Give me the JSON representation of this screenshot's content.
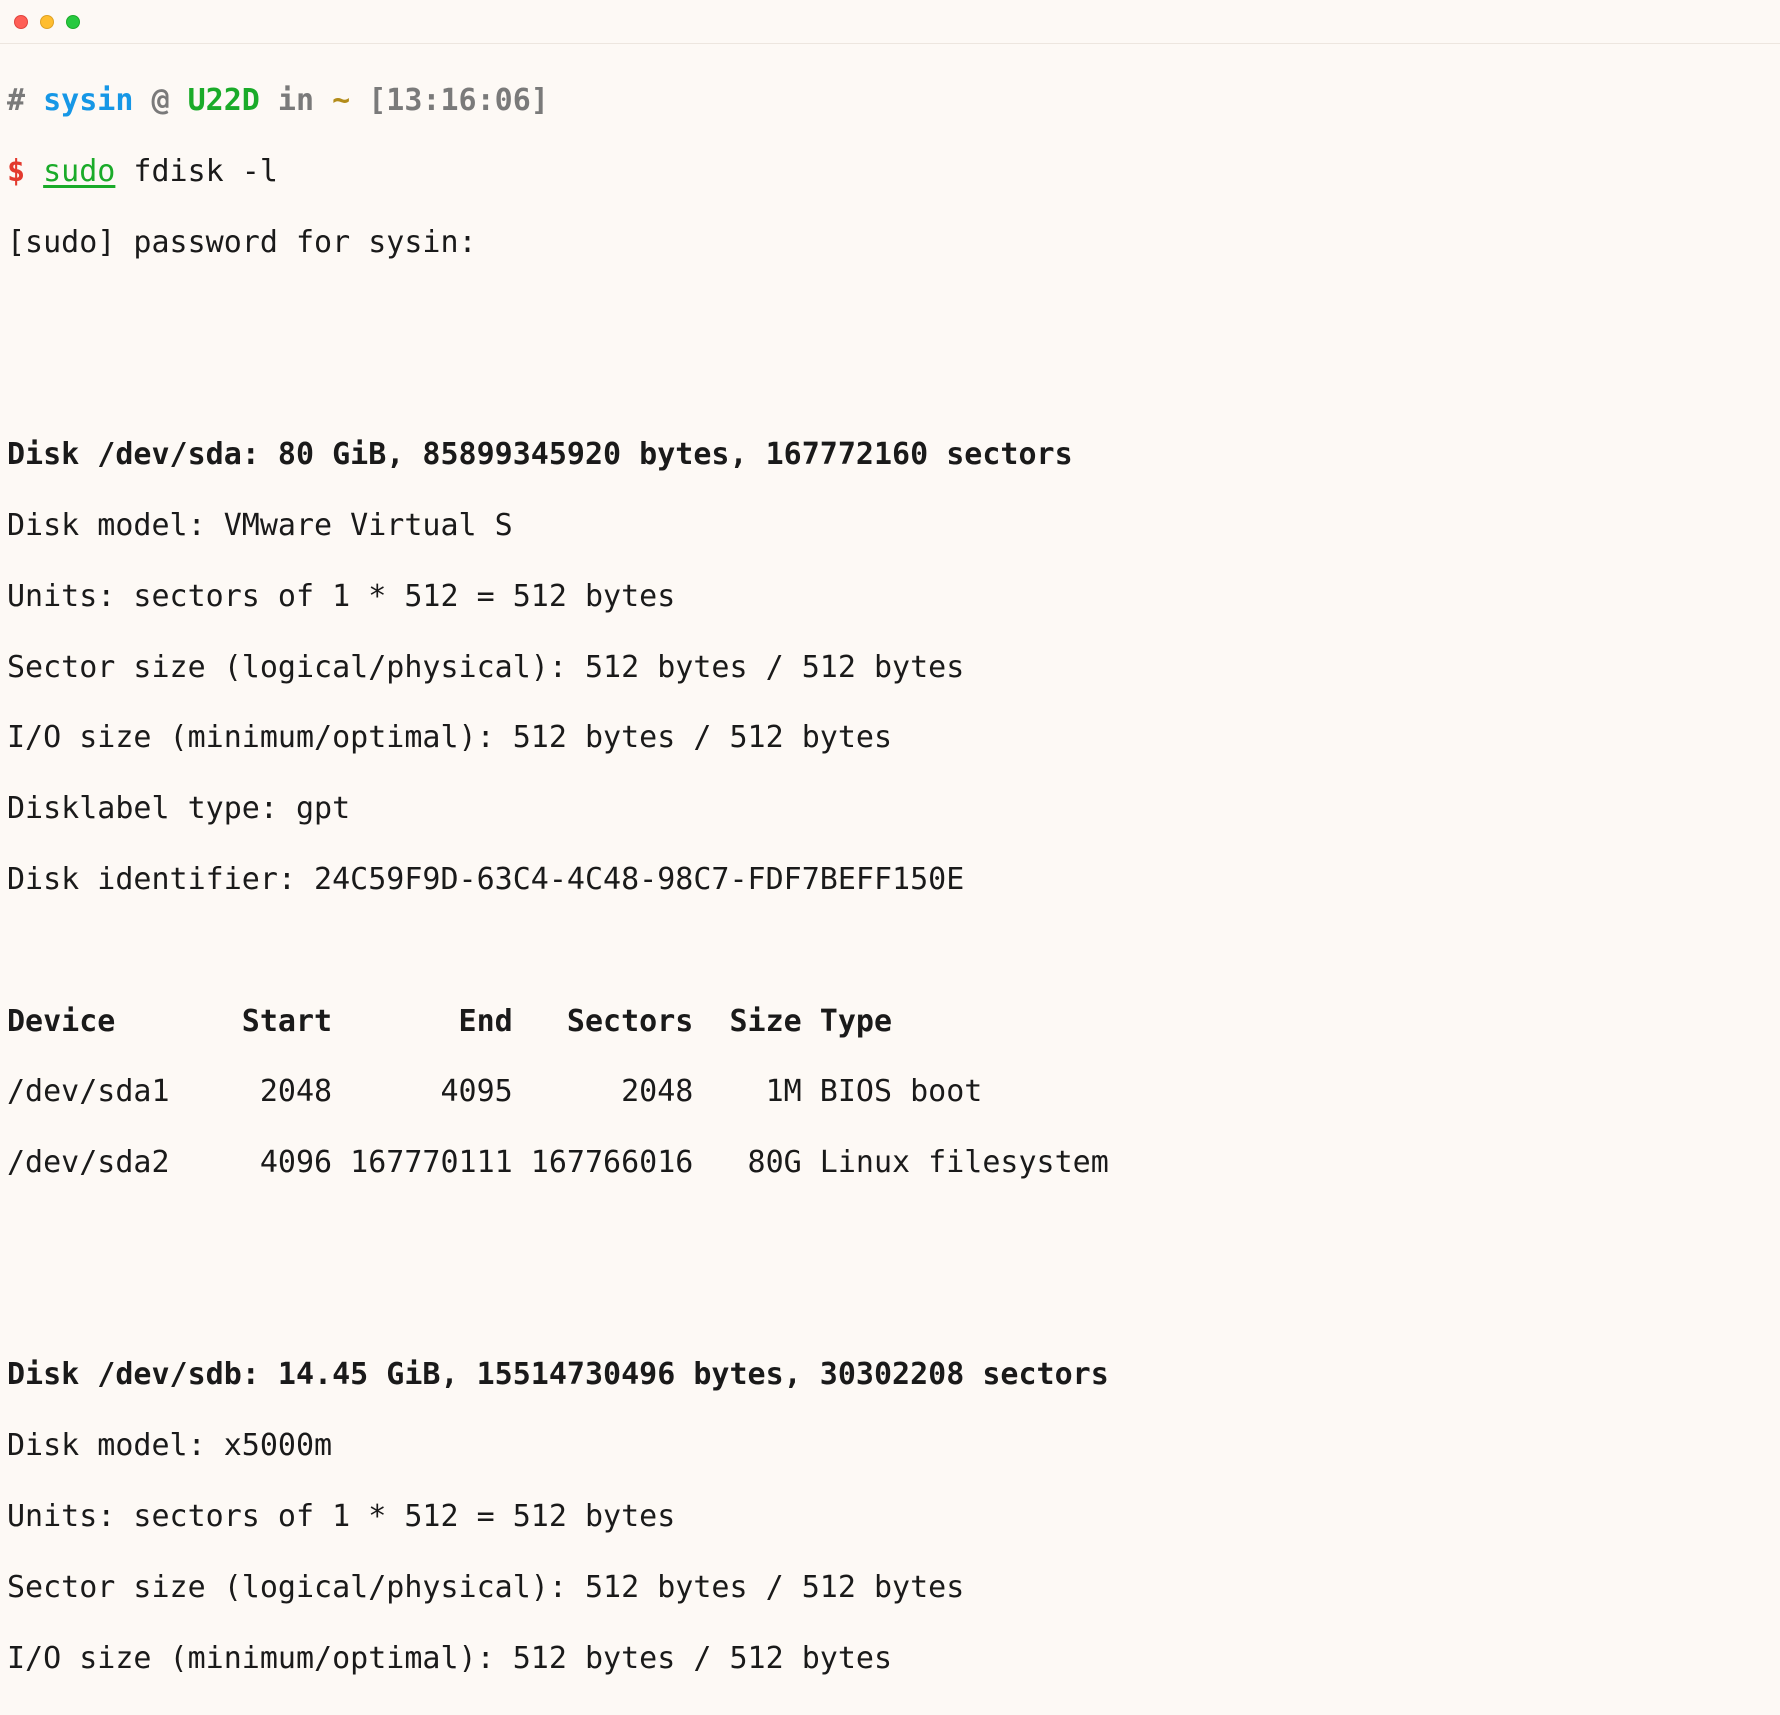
{
  "prompt": {
    "hash": "#",
    "user": "sysin",
    "at": " @ ",
    "host": "U22D",
    "in": " in ",
    "tilde": "~",
    "time": " [13:16:06]",
    "dollar": "$",
    "cmd_sudo": "sudo",
    "cmd_rest": " fdisk -l",
    "sudo_pw": "[sudo] password for sysin:"
  },
  "disk1": {
    "header": "Disk /dev/sda: 80 GiB, 85899345920 bytes, 167772160 sectors",
    "model": "Disk model: VMware Virtual S",
    "units": "Units: sectors of 1 * 512 = 512 bytes",
    "sector": "Sector size (logical/physical): 512 bytes / 512 bytes",
    "io": "I/O size (minimum/optimal): 512 bytes / 512 bytes",
    "label": "Disklabel type: gpt",
    "id": "Disk identifier: 24C59F9D-63C4-4C48-98C7-FDF7BEFF150E"
  },
  "partitions": {
    "header": "Device       Start       End   Sectors  Size Type",
    "rows": [
      "/dev/sda1     2048      4095      2048    1M BIOS boot",
      "/dev/sda2     4096 167770111 167766016   80G Linux filesystem"
    ]
  },
  "disk2": {
    "header": "Disk /dev/sdb: 14.45 GiB, 15514730496 bytes, 30302208 sectors",
    "model": "Disk model: x5000m",
    "units": "Units: sectors of 1 * 512 = 512 bytes",
    "sector": "Sector size (logical/physical): 512 bytes / 512 bytes",
    "io": "I/O size (minimum/optimal): 512 bytes / 512 bytes"
  }
}
